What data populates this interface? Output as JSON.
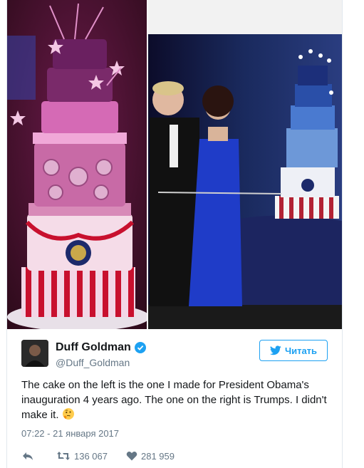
{
  "tweet": {
    "display_name": "Duff Goldman",
    "handle": "@Duff_Goldman",
    "verified": true,
    "text": "The cake on the left is the one I made for President Obama's inauguration 4 years ago. The one on the right is Trumps. I didn't make it.",
    "emoji": "thinking-face",
    "timestamp": "07:22 - 21 января 2017",
    "retweets": "136 067",
    "likes": "281 959"
  },
  "follow_button": {
    "label": "Читать"
  },
  "icons": [
    "verified-badge-icon",
    "twitter-bird-icon",
    "reply-icon",
    "retweet-icon",
    "like-icon",
    "thinking-face-emoji"
  ],
  "colors": {
    "accent": "#1da1f2",
    "secondary_text": "#657786"
  }
}
